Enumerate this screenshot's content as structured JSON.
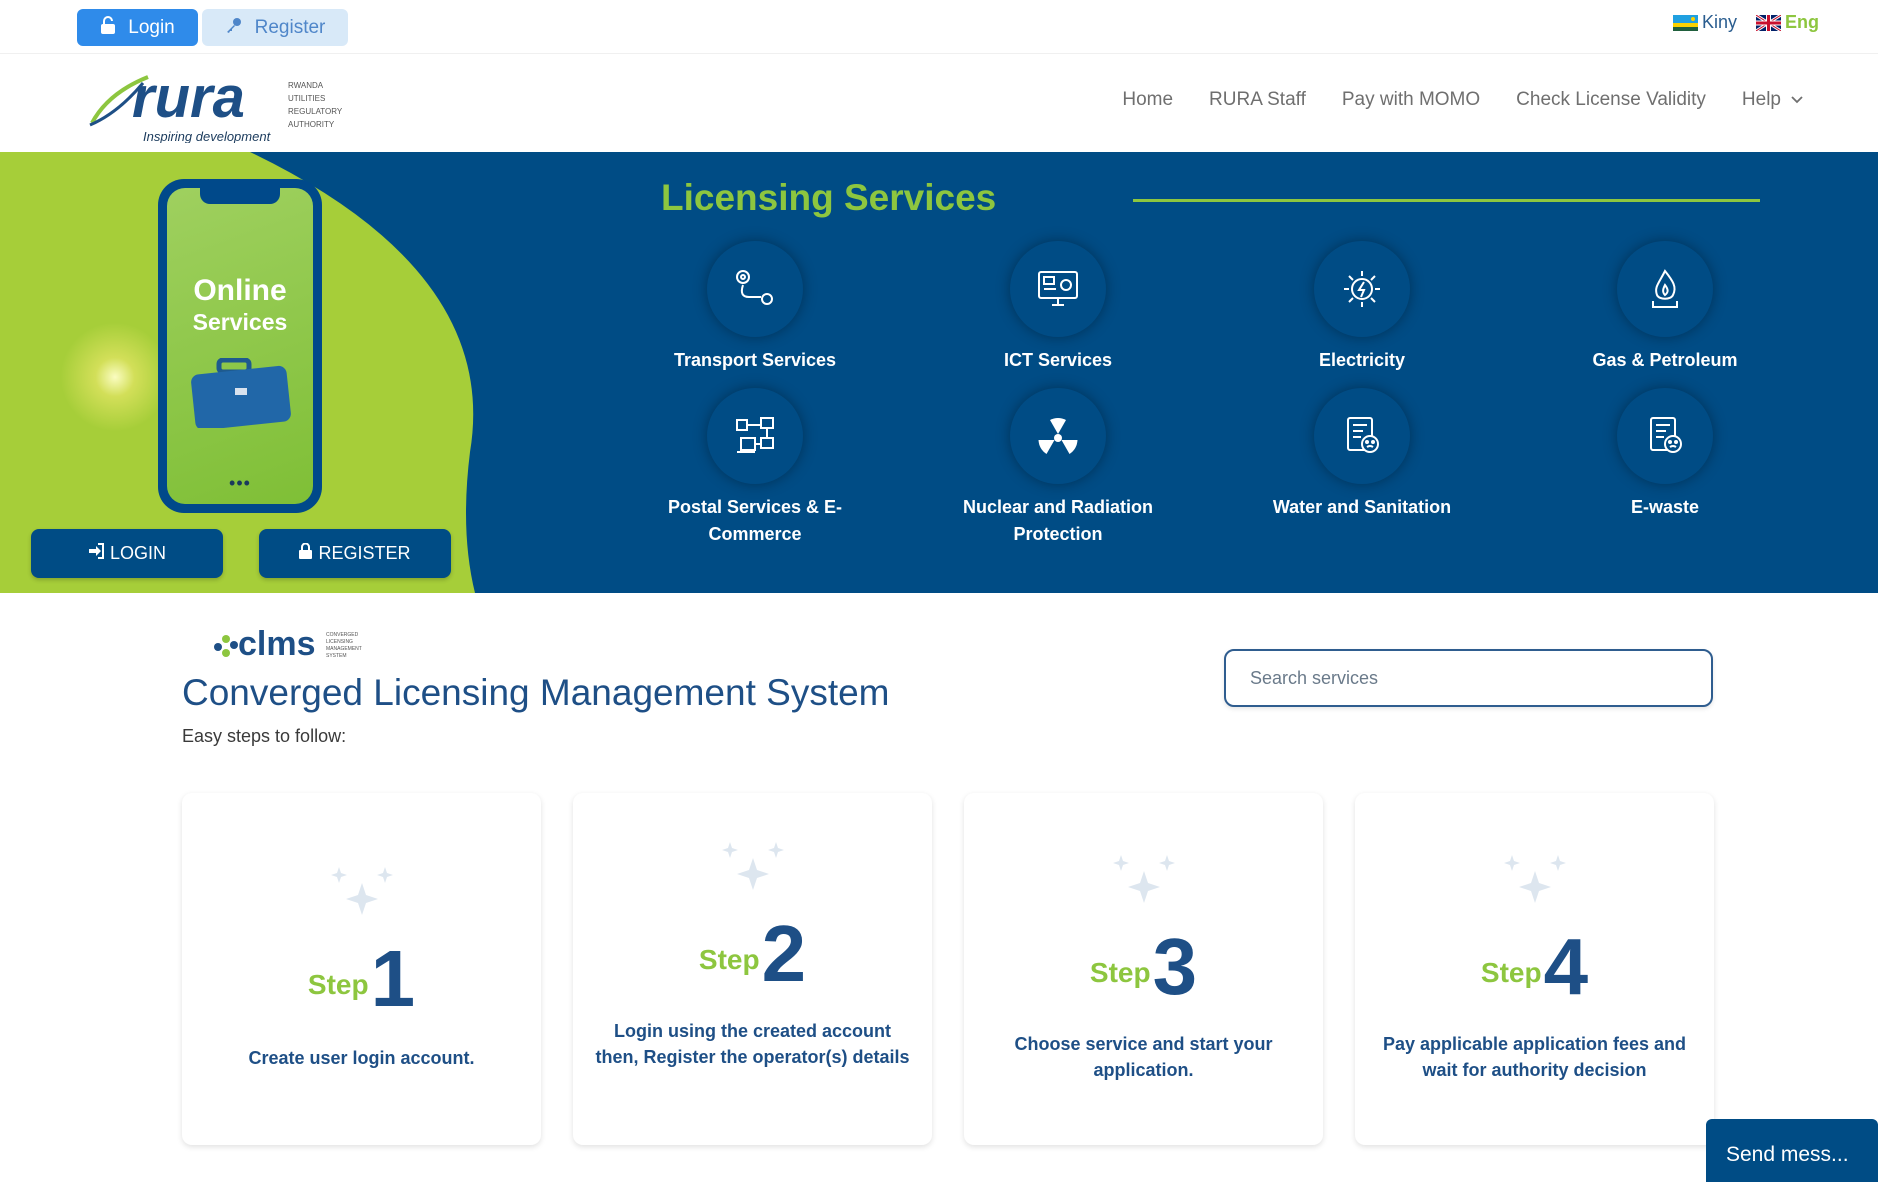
{
  "topbar": {
    "login_label": "Login",
    "register_label": "Register",
    "lang_kiny": "Kiny",
    "lang_eng": "Eng"
  },
  "logo": {
    "brand": "rura",
    "tagline": "Inspiring development",
    "line1": "RWANDA",
    "line2": "UTILITIES",
    "line3": "REGULATORY",
    "line4": "AUTHORITY"
  },
  "nav": {
    "items": [
      "Home",
      "RURA Staff",
      "Pay with MOMO",
      "Check License Validity",
      "Help"
    ]
  },
  "hero": {
    "phone_line1": "Online",
    "phone_line2": "Services",
    "phone_dots": "•••",
    "login_label": "LOGIN",
    "register_label": "REGISTER",
    "title": "Licensing Services",
    "services": [
      {
        "label": "Transport Services",
        "icon": "route-icon"
      },
      {
        "label": "ICT Services",
        "icon": "computer-icon"
      },
      {
        "label": "Electricity",
        "icon": "electricity-icon"
      },
      {
        "label": "Gas & Petroleum",
        "icon": "gas-flame-icon"
      },
      {
        "label": "Postal Services & E-Commerce",
        "icon": "postal-icon"
      },
      {
        "label": "Nuclear and Radiation Protection",
        "icon": "radiation-icon"
      },
      {
        "label": "Water and Sanitation",
        "icon": "document-face-icon"
      },
      {
        "label": "E-waste",
        "icon": "document-face-icon"
      }
    ]
  },
  "clms": {
    "logo_text": "clms",
    "logo_small1": "CONVERGED",
    "logo_small2": "LICENSING",
    "logo_small3": "MANAGEMENT",
    "logo_small4": "SYSTEM",
    "title": "Converged Licensing Management System",
    "subtitle": "Easy steps to follow:",
    "search_placeholder": "Search services"
  },
  "steps": [
    {
      "word": "Step",
      "number": "1",
      "desc": "Create user login account."
    },
    {
      "word": "Step",
      "number": "2",
      "desc": "Login using the created account then, Register the operator(s) details"
    },
    {
      "word": "Step",
      "number": "3",
      "desc": "Choose service and start your application."
    },
    {
      "word": "Step",
      "number": "4",
      "desc": "Pay applicable application fees and wait for authority decision"
    }
  ],
  "chat": {
    "label": "Send mess..."
  },
  "colors": {
    "primary": "#004c85",
    "accent": "#8dc63f",
    "login_blue": "#2f8bea"
  }
}
